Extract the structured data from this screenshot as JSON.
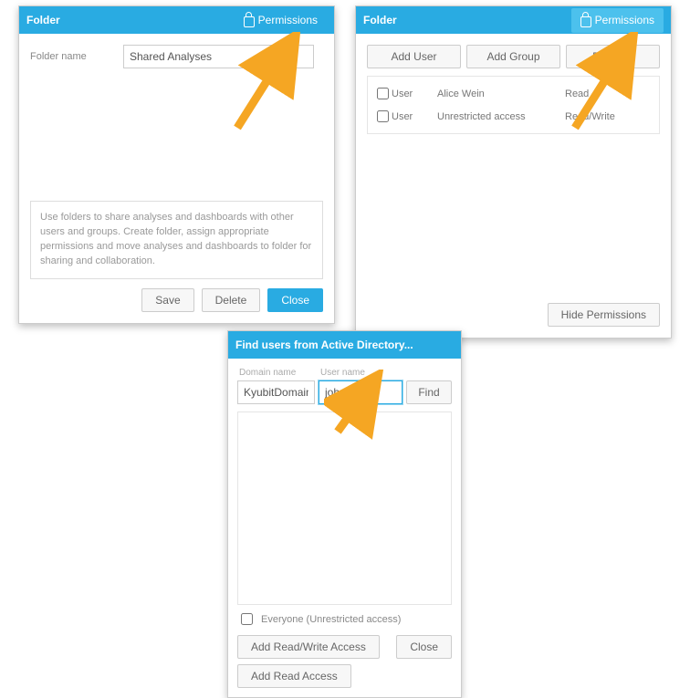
{
  "dialog1": {
    "title": "Folder",
    "perm_tab": "Permissions",
    "folder_label": "Folder name",
    "folder_value": "Shared Analyses",
    "help": "Use folders to share analyses and dashboards with other users and groups. Create folder, assign appropriate permissions and move analyses and dashboards to folder for sharing and collaboration.",
    "save": "Save",
    "delete": "Delete",
    "close": "Close"
  },
  "dialog2": {
    "title": "Folder",
    "perm_tab": "Permissions",
    "add_user": "Add User",
    "add_group": "Add Group",
    "remove": "Remove",
    "rows": [
      {
        "type": "User",
        "name": "Alice Wein",
        "perm": "Read"
      },
      {
        "type": "User",
        "name": "Unrestricted access",
        "perm": "Read/Write"
      }
    ],
    "hide": "Hide Permissions"
  },
  "dialog3": {
    "title": "Find users from Active Directory...",
    "domain_lbl": "Domain name",
    "user_lbl": "User name",
    "domain_value": "KyubitDomain",
    "user_value": "john ",
    "find": "Find",
    "everyone": "Everyone (Unrestricted access)",
    "add_rw": "Add Read/Write Access",
    "close": "Close",
    "add_r": "Add Read Access"
  }
}
